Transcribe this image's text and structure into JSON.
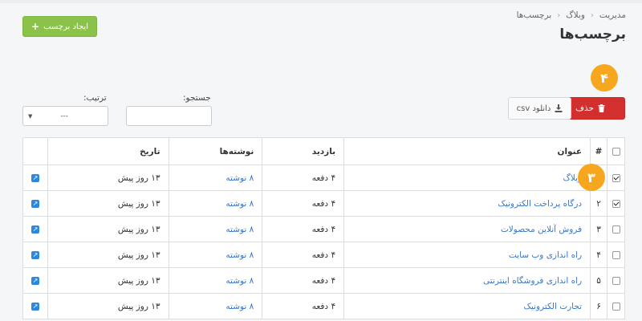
{
  "header": {
    "create_button": "ایجاد برچسب",
    "breadcrumb": [
      "مدیریت",
      "وبلاگ",
      "برچسب‌ها"
    ],
    "page_title": "برچسب‌ها"
  },
  "badges": {
    "delete_step": "۴",
    "row_step": "۳"
  },
  "toolbar": {
    "delete_button": "حذف",
    "csv_button": "دانلود csv",
    "search_label": "جستجو:",
    "search_value": "",
    "sort_label": "ترتیب:",
    "sort_value": "---"
  },
  "table": {
    "headers": {
      "num": "#",
      "title": "عنوان",
      "visits": "بازدید",
      "posts": "نوشته‌ها",
      "date": "تاریخ"
    },
    "rows": [
      {
        "checked": true,
        "num": "",
        "title": "وبلاگ",
        "visits": "۴ دفعه",
        "posts": "۸ نوشته",
        "date": "۱۳ روز پیش"
      },
      {
        "checked": true,
        "num": "۲",
        "title": "درگاه پرداخت الکترونیک",
        "visits": "۴ دفعه",
        "posts": "۸ نوشته",
        "date": "۱۳ روز پیش"
      },
      {
        "checked": false,
        "num": "۳",
        "title": "فروش آنلاین محصولات",
        "visits": "۴ دفعه",
        "posts": "۸ نوشته",
        "date": "۱۳ روز پیش"
      },
      {
        "checked": false,
        "num": "۴",
        "title": "راه اندازی وب سایت",
        "visits": "۴ دفعه",
        "posts": "۸ نوشته",
        "date": "۱۳ روز پیش"
      },
      {
        "checked": false,
        "num": "۵",
        "title": "راه اندازی فروشگاه اینترنتی",
        "visits": "۴ دفعه",
        "posts": "۸ نوشته",
        "date": "۱۳ روز پیش"
      },
      {
        "checked": false,
        "num": "۶",
        "title": "تجارت الکترونیک",
        "visits": "۴ دفعه",
        "posts": "۸ نوشته",
        "date": "۱۳ روز پیش"
      }
    ]
  },
  "colors": {
    "create": "#8bc34a",
    "delete": "#d32f2f",
    "badge": "#f7a71e",
    "link": "#3a77c7",
    "edit_icon": "#2e86de"
  },
  "icons": {
    "create": "plus-icon",
    "delete": "trash-icon",
    "csv": "download-icon",
    "edit": "edit-icon",
    "sort": "caret-down-icon"
  }
}
